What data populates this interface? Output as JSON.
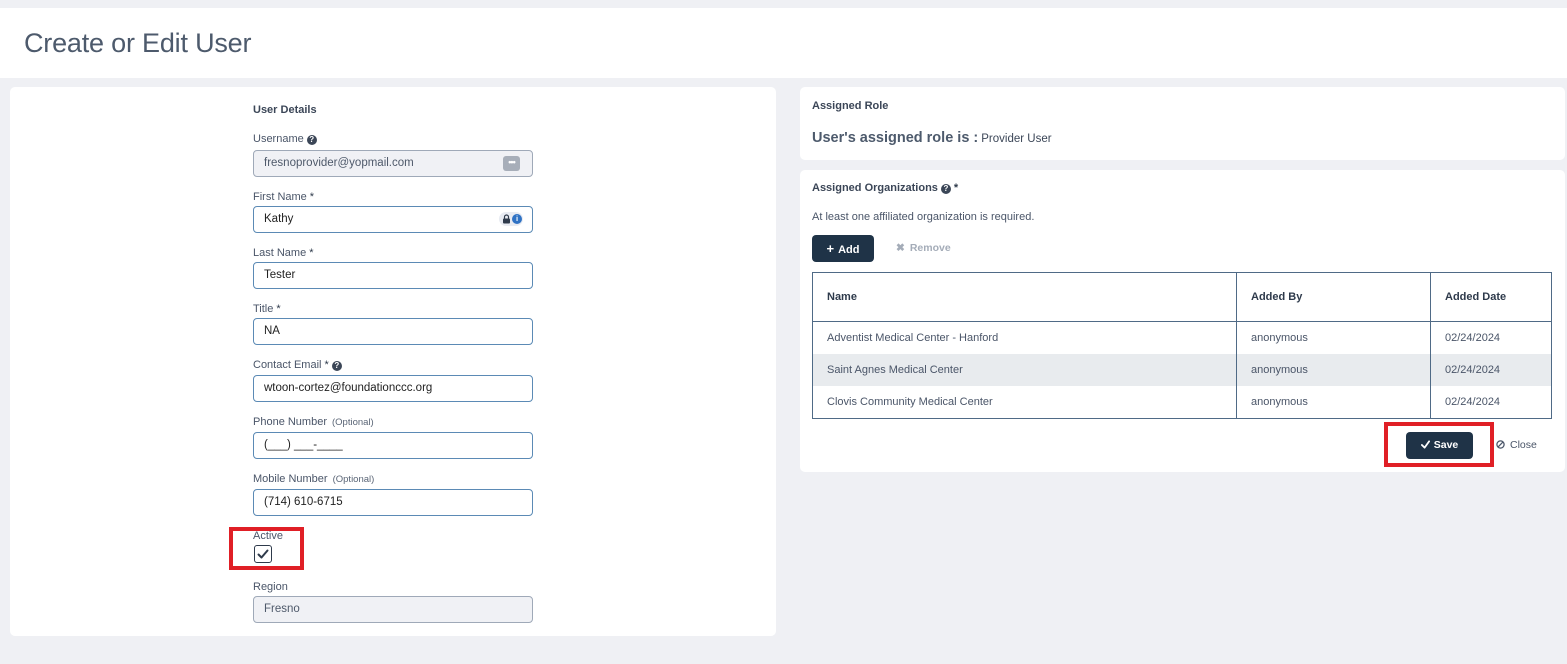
{
  "page": {
    "title": "Create or Edit User"
  },
  "user_details": {
    "section_title": "User Details",
    "username": {
      "label": "Username",
      "value": "fresnoprovider@yopmail.com"
    },
    "first_name": {
      "label": "First Name",
      "required": "*",
      "value": "Kathy"
    },
    "last_name": {
      "label": "Last Name",
      "required": "*",
      "value": "Tester"
    },
    "title": {
      "label": "Title",
      "required": "*",
      "value": "NA"
    },
    "contact_email": {
      "label": "Contact Email",
      "required": "*",
      "value": "wtoon-cortez@foundationccc.org"
    },
    "phone": {
      "label": "Phone Number",
      "optional": "(Optional)",
      "value": "(___) ___-____"
    },
    "mobile": {
      "label": "Mobile Number",
      "optional": "(Optional)",
      "value": "(714) 610-6715"
    },
    "active": {
      "label": "Active",
      "checked": true
    },
    "region": {
      "label": "Region",
      "value": "Fresno"
    }
  },
  "assigned_role": {
    "title": "Assigned Role",
    "prefix": "User's assigned role is :",
    "value": "Provider User"
  },
  "assigned_orgs": {
    "title": "Assigned Organizations",
    "required": "*",
    "note": "At least one affiliated organization is required.",
    "add_label": "Add",
    "remove_label": "Remove",
    "columns": [
      "Name",
      "Added By",
      "Added Date"
    ],
    "rows": [
      [
        "Adventist Medical Center - Hanford",
        "anonymous",
        "02/24/2024"
      ],
      [
        "Saint Agnes Medical Center",
        "anonymous",
        "02/24/2024"
      ],
      [
        "Clovis Community Medical Center",
        "anonymous",
        "02/24/2024"
      ]
    ]
  },
  "actions": {
    "save_label": "Save",
    "close_label": "Close"
  },
  "icons": {
    "help": "question-circle-icon",
    "more": "ellipsis-icon",
    "lock": "lock-icon",
    "info": "info-icon",
    "check": "check-icon",
    "plus": "plus-icon",
    "remove": "x-icon",
    "close": "ban-icon"
  },
  "colors": {
    "primary_button": "#1f3347",
    "highlight": "#e01f26",
    "field_border": "#5b8ab5"
  }
}
